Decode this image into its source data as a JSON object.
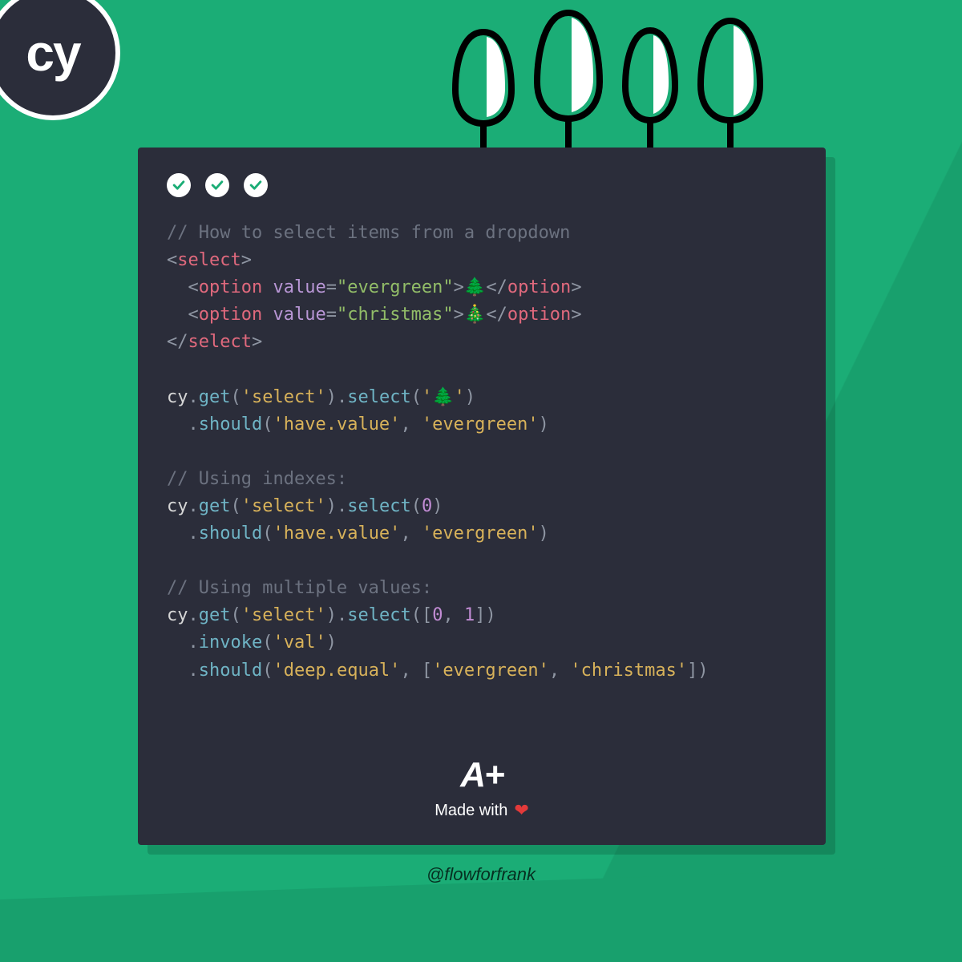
{
  "logo": {
    "text": "cy"
  },
  "code": {
    "comment1": "// How to select items from a dropdown",
    "select_open": "select",
    "option_tag": "option",
    "attr_value": "value",
    "val_evergreen": "\"evergreen\"",
    "val_christmas": "\"christmas\"",
    "tree_emoji1": "🌲",
    "tree_emoji2": "🎄",
    "cy": "cy",
    "get": "get",
    "select_fn": "select",
    "should": "should",
    "invoke": "invoke",
    "str_select": "'select'",
    "str_tree": "'🌲'",
    "str_havevalue": "'have.value'",
    "str_evergreen": "'evergreen'",
    "str_christmas": "'christmas'",
    "comment2": "// Using indexes:",
    "num0": "0",
    "num1": "1",
    "comment3": "// Using multiple values:",
    "str_val": "'val'",
    "str_deepequal": "'deep.equal'"
  },
  "footer": {
    "aplus": "A+",
    "madewith": "Made with"
  },
  "handle": "@flowforfrank"
}
